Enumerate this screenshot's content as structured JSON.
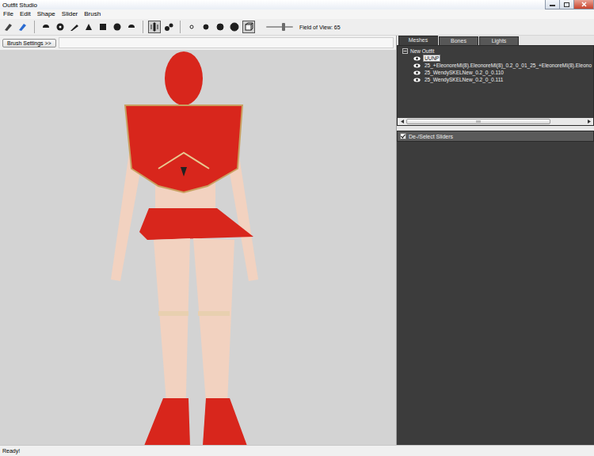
{
  "window": {
    "title": "Outfit Studio"
  },
  "menu": [
    "File",
    "Edit",
    "Shape",
    "Slider",
    "Brush"
  ],
  "toolbar": {
    "groups": [
      [
        {
          "selected": false
        },
        {
          "selected": false
        }
      ],
      [
        {
          "selected": false
        },
        {
          "selected": false
        },
        {
          "selected": false
        },
        {
          "selected": false
        },
        {
          "selected": false
        },
        {
          "selected": false
        },
        {
          "selected": false
        }
      ],
      [
        {
          "selected": true
        },
        {
          "selected": false
        }
      ],
      [
        {
          "selected": false
        },
        {
          "selected": false
        },
        {
          "selected": false
        },
        {
          "selected": false
        },
        {
          "selected": true
        }
      ]
    ],
    "slider": {
      "level": 0.65
    },
    "field_of_view": "Field of View: 65"
  },
  "brush_settings": "Brush Settings >>",
  "tabs": [
    {
      "label": "Meshes",
      "selected": true
    },
    {
      "label": "Bones",
      "selected": false
    },
    {
      "label": "Lights",
      "selected": false
    }
  ],
  "tree": {
    "root": {
      "label": "New Outfit",
      "expanded": true
    },
    "items": [
      {
        "label": "UUNP",
        "selected": true
      },
      {
        "label": "25_+EleonoreMI(8).EleonoreMI(8)_0.2_0_01_25_+EleonoreMI(8).Eleono",
        "selected": false
      },
      {
        "label": "25_WendySKELNew_0.2_0_0.110",
        "selected": false
      },
      {
        "label": "25_WendySKELNew_0.2_0_0.111",
        "selected": false
      }
    ]
  },
  "sliders_panel": {
    "label": "De-/Select Sliders",
    "checked": true
  },
  "status_bar": "Ready!"
}
